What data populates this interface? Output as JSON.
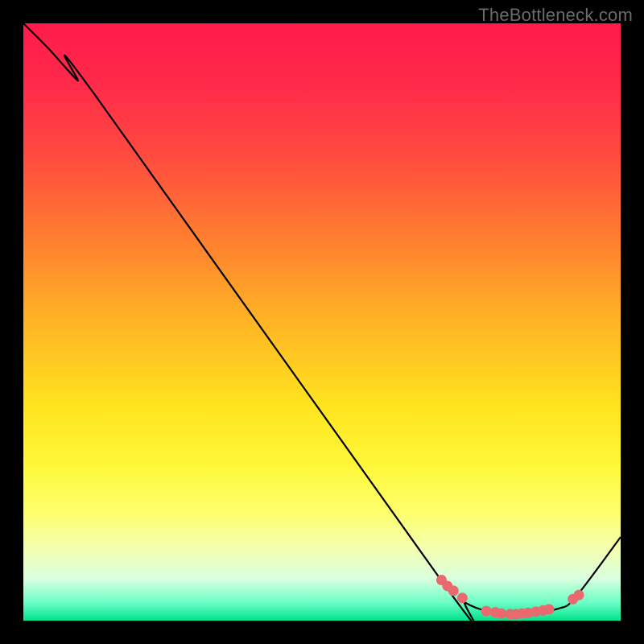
{
  "watermark": "TheBottleneck.com",
  "chart_data": {
    "type": "line",
    "title": "",
    "xlabel": "",
    "ylabel": "",
    "xlim": [
      0,
      1
    ],
    "ylim": [
      0,
      1
    ],
    "series": [
      {
        "name": "bottleneck-curve",
        "x": [
          0.0,
          0.04,
          0.09,
          0.12,
          0.705,
          0.74,
          0.78,
          0.83,
          0.895,
          0.925,
          1.0
        ],
        "y": [
          1.0,
          0.96,
          0.905,
          0.88,
          0.06,
          0.03,
          0.015,
          0.01,
          0.02,
          0.04,
          0.14
        ]
      }
    ],
    "highlight_points": {
      "name": "bottleneck-range-markers",
      "x": [
        0.7,
        0.71,
        0.72,
        0.735,
        0.775,
        0.79,
        0.8,
        0.815,
        0.825,
        0.835,
        0.845,
        0.858,
        0.87,
        0.88,
        0.92,
        0.93
      ],
      "y": [
        0.068,
        0.058,
        0.05,
        0.038,
        0.016,
        0.014,
        0.012,
        0.011,
        0.011,
        0.012,
        0.013,
        0.015,
        0.017,
        0.019,
        0.036,
        0.043
      ]
    },
    "background": "red-yellow-green vertical gradient"
  }
}
